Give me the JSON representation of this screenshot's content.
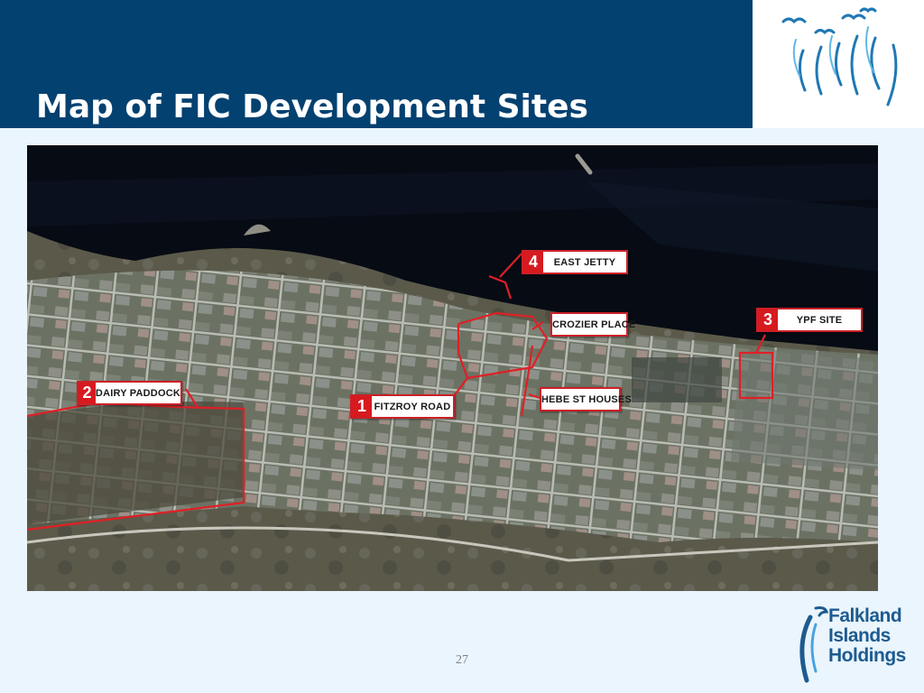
{
  "slide": {
    "title": "Map of FIC Development Sites",
    "page_number": "27"
  },
  "colors": {
    "header_band": "#034170",
    "background": "#eaf5fd",
    "marker_red": "#d71920",
    "logo_blue": "#1d5b8f"
  },
  "map": {
    "sites": [
      {
        "number": "1",
        "name": "FITZROY ROAD"
      },
      {
        "number": "2",
        "name": "DAIRY PADDOCK"
      },
      {
        "number": "3",
        "name": "YPF SITE"
      },
      {
        "number": "4",
        "name": "EAST JETTY"
      },
      {
        "number": "",
        "name": "CROZIER PLACE"
      },
      {
        "number": "",
        "name": "HEBE ST HOUSES"
      }
    ]
  },
  "logos": {
    "top_right": "birds-logo-icon",
    "bottom_right": {
      "icon": "falkland-bird-icon",
      "lines": [
        "Falkland",
        "Islands",
        "Holdings"
      ]
    }
  }
}
